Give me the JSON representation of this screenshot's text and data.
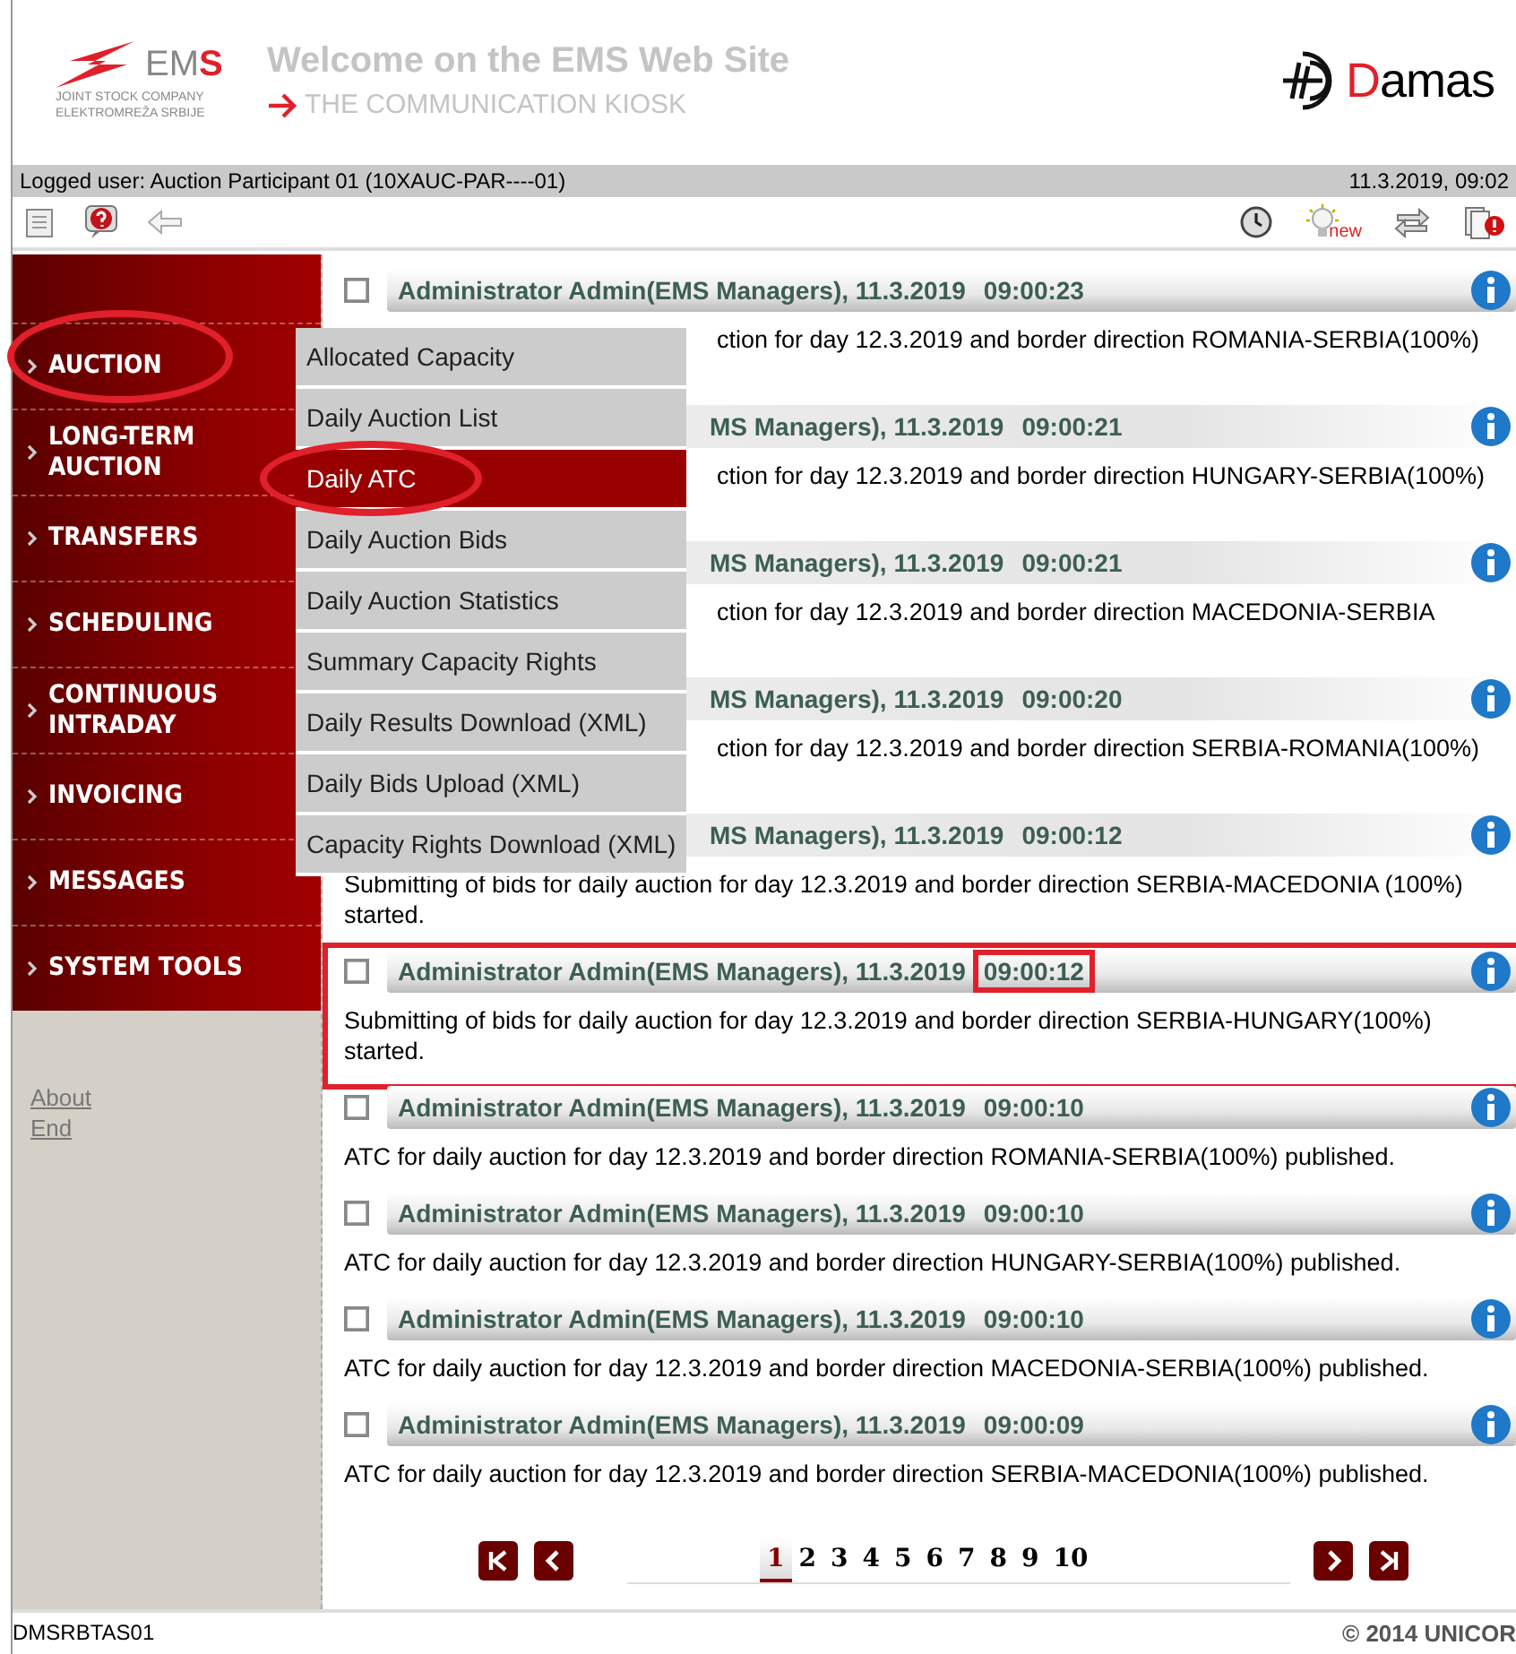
{
  "header": {
    "company_logo": {
      "name": "EMS",
      "line1": "JOINT STOCK COMPANY",
      "line2": "ELEKTROMREŽA SRBIJE"
    },
    "title": "Welcome on the EMS Web Site",
    "subtitle": "THE COMMUNICATION KIOSK",
    "product_logo": "Damas"
  },
  "user_bar": {
    "user": "Logged user: Auction Participant 01 (10XAUC-PAR----01)",
    "datetime": "11.3.2019, 09:02"
  },
  "toolbar": {
    "new_badge": "new"
  },
  "sidebar": {
    "items": [
      {
        "label": "AUCTION",
        "circled": true
      },
      {
        "label": "LONG-TERM AUCTION",
        "circled": false
      },
      {
        "label": "TRANSFERS",
        "circled": false
      },
      {
        "label": "SCHEDULING",
        "circled": false
      },
      {
        "label": "CONTINUOUS INTRADAY",
        "circled": false
      },
      {
        "label": "INVOICING",
        "circled": false
      },
      {
        "label": "MESSAGES",
        "circled": false
      },
      {
        "label": "SYSTEM TOOLS",
        "circled": false
      }
    ],
    "links": [
      "About",
      "End"
    ]
  },
  "dropdown_menu": {
    "items": [
      {
        "label": "Allocated Capacity",
        "selected": false,
        "circled": false
      },
      {
        "label": "Daily Auction List",
        "selected": false,
        "circled": false
      },
      {
        "label": "Daily ATC",
        "selected": true,
        "circled": true
      },
      {
        "label": "Daily Auction Bids",
        "selected": false,
        "circled": false
      },
      {
        "label": "Daily Auction Statistics",
        "selected": false,
        "circled": false
      },
      {
        "label": "Summary Capacity Rights",
        "selected": false,
        "circled": false
      },
      {
        "label": "Daily Results Download (XML)",
        "selected": false,
        "circled": false
      },
      {
        "label": "Daily Bids Upload (XML)",
        "selected": false,
        "circled": false
      },
      {
        "label": "Capacity Rights Download (XML)",
        "selected": false,
        "circled": false
      }
    ]
  },
  "messages": [
    {
      "checked": false,
      "header": "Administrator Admin(EMS Managers), 11.3.2019",
      "time": "09:00:23",
      "header_cut": false,
      "body": "ction for day 12.3.2019 and border direction ROMANIA-SERBIA(100%)",
      "body_cut": true,
      "highlighted": false,
      "time_marked": false
    },
    {
      "header": "MS Managers), 11.3.2019",
      "time": "09:00:21",
      "header_cut": true,
      "body": "ction for day 12.3.2019 and border direction HUNGARY-SERBIA(100%)",
      "body_cut": true,
      "highlighted": false,
      "time_marked": false
    },
    {
      "header": "MS Managers), 11.3.2019",
      "time": "09:00:21",
      "header_cut": true,
      "body": "ction for day 12.3.2019 and border direction MACEDONIA-SERBIA",
      "body_cut": true,
      "highlighted": false,
      "time_marked": false
    },
    {
      "header": "MS Managers), 11.3.2019",
      "time": "09:00:20",
      "header_cut": true,
      "body": "ction for day 12.3.2019 and border direction SERBIA-ROMANIA(100%)",
      "body_cut": true,
      "highlighted": false,
      "time_marked": false
    },
    {
      "header": "MS Managers), 11.3.2019",
      "time": "09:00:12",
      "header_cut": true,
      "body": "Submitting of bids for daily auction for day 12.3.2019 and border direction SERBIA-MACEDONIA (100%) started.",
      "body_cut": false,
      "highlighted": false,
      "time_marked": false
    },
    {
      "checked": false,
      "header": "Administrator Admin(EMS Managers), 11.3.2019",
      "time": "09:00:12",
      "header_cut": false,
      "body": "Submitting of bids for daily auction for day 12.3.2019 and border direction SERBIA-HUNGARY(100%) started.",
      "body_cut": false,
      "highlighted": true,
      "time_marked": true
    },
    {
      "checked": false,
      "header": "Administrator Admin(EMS Managers), 11.3.2019",
      "time": "09:00:10",
      "header_cut": false,
      "body": "ATC for daily auction for day 12.3.2019 and border direction ROMANIA-SERBIA(100%) published.",
      "body_cut": false,
      "highlighted": false,
      "time_marked": false
    },
    {
      "checked": false,
      "header": "Administrator Admin(EMS Managers), 11.3.2019",
      "time": "09:00:10",
      "header_cut": false,
      "body": "ATC for daily auction for day 12.3.2019 and border direction HUNGARY-SERBIA(100%) published.",
      "body_cut": false,
      "highlighted": false,
      "time_marked": false
    },
    {
      "checked": false,
      "header": "Administrator Admin(EMS Managers), 11.3.2019",
      "time": "09:00:10",
      "header_cut": false,
      "body": "ATC for daily auction for day 12.3.2019 and border direction MACEDONIA-SERBIA(100%) published.",
      "body_cut": false,
      "highlighted": false,
      "time_marked": false
    },
    {
      "checked": false,
      "header": "Administrator Admin(EMS Managers), 11.3.2019",
      "time": "09:00:09",
      "header_cut": false,
      "body": "ATC for daily auction for day 12.3.2019 and border direction SERBIA-MACEDONIA(100%) published.",
      "body_cut": false,
      "highlighted": false,
      "time_marked": false
    }
  ],
  "pagination": {
    "pages": [
      {
        "label": "1",
        "selected": true
      },
      {
        "label": "2",
        "selected": false
      },
      {
        "label": "3",
        "selected": false
      },
      {
        "label": "4",
        "selected": false
      },
      {
        "label": "5",
        "selected": false
      },
      {
        "label": "6",
        "selected": false
      },
      {
        "label": "7",
        "selected": false
      },
      {
        "label": "8",
        "selected": false
      },
      {
        "label": "9",
        "selected": false
      },
      {
        "label": "10",
        "selected": false
      }
    ]
  },
  "footer": {
    "server": "DMSRBTAS01",
    "copyright": "© 2014 UNICOR"
  }
}
